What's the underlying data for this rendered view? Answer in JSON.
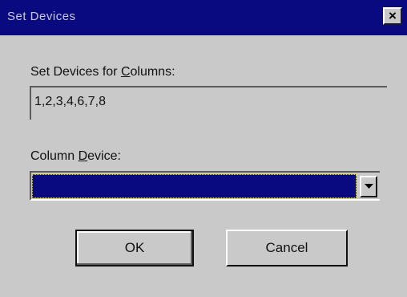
{
  "window": {
    "title": "Set Devices",
    "close_label": "×"
  },
  "columns_field": {
    "label_before": "Set Devices for ",
    "label_accel": "C",
    "label_after": "olumns:",
    "value": "1,2,3,4,6,7,8"
  },
  "device_field": {
    "label_before": "Column ",
    "label_accel": "D",
    "label_after": "evice:",
    "selected_value": ""
  },
  "buttons": {
    "ok_label": "OK",
    "cancel_label": "Cancel"
  },
  "colors": {
    "titlebar": "#0a0a80",
    "dialog_face": "#c9c9c9",
    "selection": "#0a0a80"
  }
}
